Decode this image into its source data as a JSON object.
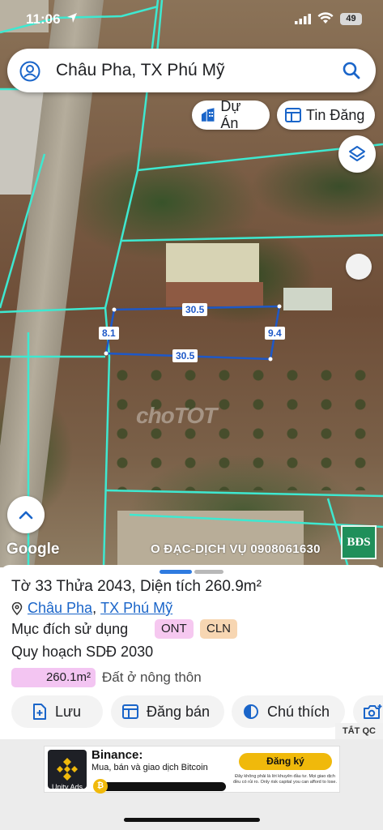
{
  "status_bar": {
    "time": "11:06",
    "battery": "49"
  },
  "search": {
    "text": "Châu Pha, TX Phú Mỹ"
  },
  "chips": {
    "du_an": "Dự Án",
    "tin_dang": "Tin Đăng"
  },
  "map": {
    "dimensions": {
      "top": "30.5",
      "bottom": "30.5",
      "left": "8.1",
      "right": "9.4"
    },
    "watermark": "choTOT",
    "google": "Google",
    "service_text": "O ĐẠC-DỊCH VỤ 0908061630",
    "logo_text": "BĐS"
  },
  "parcel": {
    "title": "Tờ 33 Thửa 2043, Diện tích 260.9m²",
    "ward": "Châu Pha",
    "separator": ",",
    "town": "TX Phú Mỹ",
    "purpose_label": "Mục đích sử dụng",
    "tags": [
      "ONT",
      "CLN"
    ],
    "plan_label": "Quy hoạch SDĐ 2030",
    "area_value": "260.1m²",
    "area_desc": "Đất ở nông thôn"
  },
  "actions": {
    "save": "Lưu",
    "post": "Đăng bán",
    "legend": "Chú thích"
  },
  "ad": {
    "close_label": "TẮT QC",
    "brand": "Binance:",
    "tagline": "Mua, bán và giao dịch Bitcoin",
    "cta": "Đăng ký",
    "disclaimer": "Đây không phải là lời khuyên đầu tư. Mọi giao dịch đều có rủi ro. Only risk capital you can afford to lose.",
    "network": "Unity Ads"
  },
  "colors": {
    "parcel_line": "#1e58c7",
    "grid_line": "#3ee8d0",
    "accent": "#1a65c9",
    "ont": "#f6c8f0",
    "cln": "#f7d6b2"
  }
}
